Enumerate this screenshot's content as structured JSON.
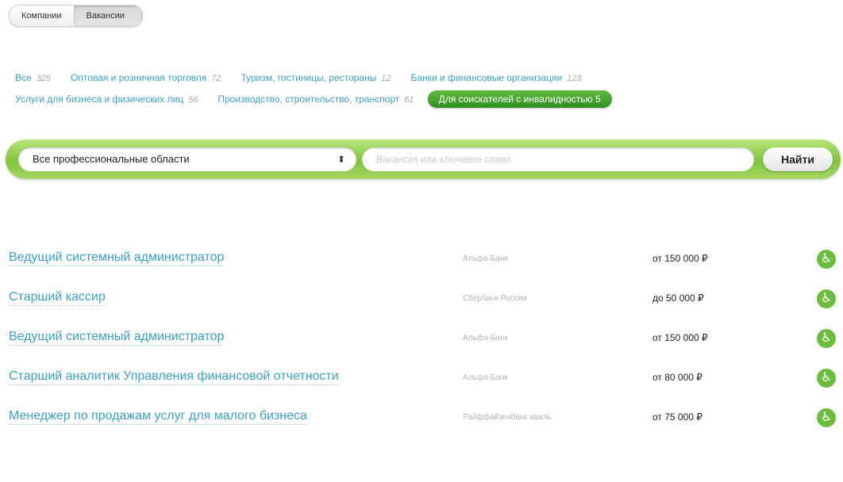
{
  "toggle": {
    "companies": "Компании",
    "vacancies": "Вакансии"
  },
  "categories": {
    "row1": [
      {
        "label": "Все",
        "count": "325"
      },
      {
        "label": "Оптовая и розничная торговля",
        "count": "72"
      },
      {
        "label": "Туризм, гостиницы, рестораны",
        "count": "12"
      },
      {
        "label": "Банки и финансовые организации",
        "count": "123"
      }
    ],
    "row2": [
      {
        "label": "Услуги для бизнеса и физических лиц",
        "count": "56"
      },
      {
        "label": "Производство, строительство, транспорт",
        "count": "61"
      }
    ],
    "highlight": "Для соискателей с инвалидностью 5"
  },
  "search": {
    "select_value": "Все профессиональные области",
    "select_arrows": "⬍",
    "placeholder": "Вакансия или ключевое слово",
    "button": "Найти"
  },
  "vacancies": [
    {
      "title": "Ведущий системный администратор",
      "company": "Альфа-Банк",
      "salary": "от 150 000 ₽"
    },
    {
      "title": "Старший кассир",
      "company": "Сбербанк России",
      "salary": "до 50 000 ₽"
    },
    {
      "title": "Ведущий системный администратор",
      "company": "Альфа-Банк",
      "salary": "от 150 000 ₽"
    },
    {
      "title": "Старший аналитик Управления финансовой отчетности",
      "company": "Альфа-Банк",
      "salary": "от 80 000 ₽"
    },
    {
      "title": "Менеджер по продажам услуг для малого бизнеса",
      "company": "Райффайзенбанк аваль",
      "salary": "от 75 000 ₽"
    }
  ],
  "colors": {
    "link": "#3aa0cf",
    "green": "#6cbd3f",
    "pill_dark": "#2e8d22"
  },
  "icons": {
    "accessibility": "wheelchair-icon",
    "select_arrows": "updown-arrows-icon"
  }
}
